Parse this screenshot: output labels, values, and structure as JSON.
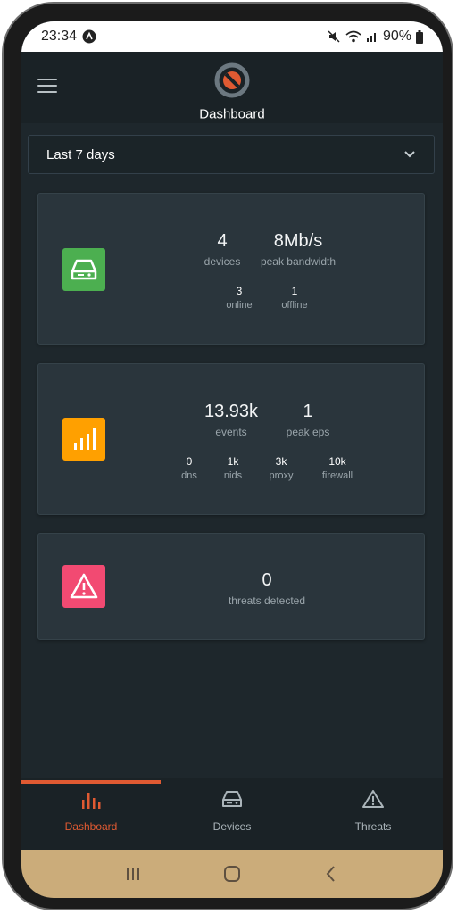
{
  "status_bar": {
    "time": "23:34",
    "battery": "90%",
    "icons": [
      "app-notification-icon",
      "mute-icon",
      "wifi-icon",
      "signal-icon",
      "battery-icon"
    ]
  },
  "header": {
    "title": "Dashboard",
    "menu_icon": "hamburger-menu-icon",
    "logo_icon": "app-logo"
  },
  "range_selector": {
    "value": "Last 7 days",
    "icon": "chevron-down-icon"
  },
  "devices_card": {
    "icon": "server-drive-icon",
    "icon_color": "#4caf50",
    "devices_value": "4",
    "devices_label": "devices",
    "bandwidth_value": "8Mb/s",
    "bandwidth_label": "peak bandwidth",
    "online_value": "3",
    "online_label": "online",
    "offline_value": "1",
    "offline_label": "offline"
  },
  "events_card": {
    "icon": "bar-chart-icon",
    "icon_color": "#ffa000",
    "events_value": "13.93k",
    "events_label": "events",
    "eps_value": "1",
    "eps_label": "peak eps",
    "dns_value": "0",
    "dns_label": "dns",
    "nids_value": "1k",
    "nids_label": "nids",
    "proxy_value": "3k",
    "proxy_label": "proxy",
    "firewall_value": "10k",
    "firewall_label": "firewall"
  },
  "threats_card": {
    "icon": "warning-triangle-icon",
    "icon_color": "#f24a72",
    "threats_value": "0",
    "threats_label": "threats detected"
  },
  "bottom_nav": {
    "active": "Dashboard",
    "accent": "#e05a32",
    "items": [
      {
        "label": "Dashboard",
        "icon": "bar-chart-icon"
      },
      {
        "label": "Devices",
        "icon": "server-drive-icon"
      },
      {
        "label": "Threats",
        "icon": "warning-triangle-icon"
      }
    ]
  },
  "system_nav": {
    "buttons": [
      "recents-icon",
      "home-icon",
      "back-icon"
    ]
  }
}
